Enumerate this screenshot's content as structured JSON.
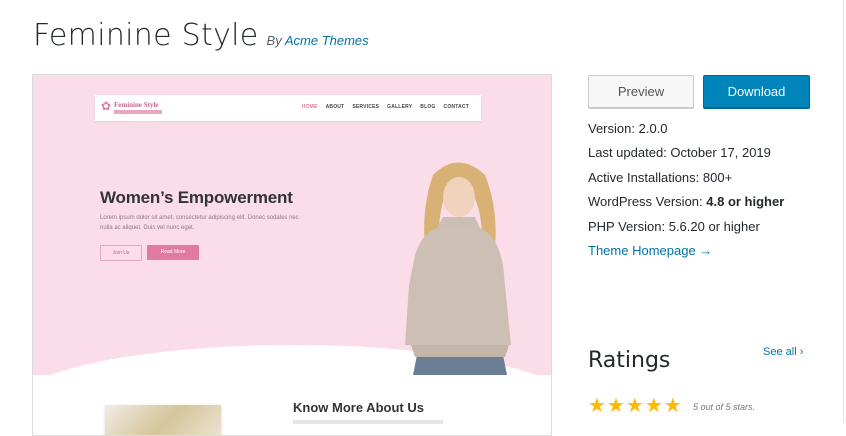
{
  "theme": {
    "name": "Feminine Style",
    "by_prefix": "By",
    "author": "Acme Themes"
  },
  "screenshot": {
    "logo_title": "Feminine Style",
    "menu": [
      "HOME",
      "ABOUT",
      "SERVICES",
      "GALLERY",
      "BLOG",
      "CONTACT"
    ],
    "hero_heading": "Women’s Empowerment",
    "hero_text": "Lorem ipsum dolor sit amet, consectetur adipiscing elit. Donec sodales nec nulla ac aliquet. Duis vel nunc eget.",
    "button_join": "Join Us",
    "button_read": "Read More",
    "about_heading": "Know More About Us",
    "accent_color": "#e07aa0",
    "hero_bg": "#fbdde9"
  },
  "actions": {
    "preview": "Preview",
    "download": "Download"
  },
  "meta": {
    "version_label": "Version:",
    "version": "2.0.0",
    "updated_label": "Last updated:",
    "updated": "October 17, 2019",
    "installs_label": "Active Installations:",
    "installs": "800+",
    "wp_label": "WordPress Version:",
    "wp": "4.8 or higher",
    "php_label": "PHP Version:",
    "php": "5.6.20 or higher",
    "homepage_link": "Theme Homepage →"
  },
  "ratings": {
    "title": "Ratings",
    "see_all": "See all",
    "stars_count": 5,
    "stars_text": "5 out of 5 stars."
  },
  "colors": {
    "link": "#0073aa",
    "download_btn": "#0085ba",
    "star": "#ffb900"
  }
}
